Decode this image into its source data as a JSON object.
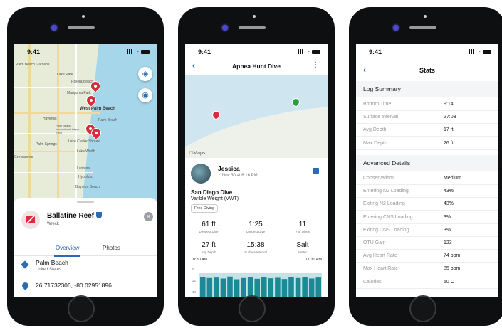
{
  "phone1": {
    "status_time": "9:41",
    "map_labels": [
      "Palm Beach Gardens",
      "Lake Park",
      "Riviera Beach",
      "Mangonia Park",
      "West Palm Beach",
      "Palm Beach",
      "Haverhill",
      "Palm Beach International Airport (PBI)",
      "Palm Springs",
      "Lake Clarke Shores",
      "Greenacres",
      "Lake Worth",
      "Lantana",
      "Hypoluxo",
      "Boynton Beach"
    ],
    "reef_title": "Ballatine Reef",
    "reef_type": "Wreck",
    "tabs": [
      "Overview",
      "Photos"
    ],
    "location_name": "Palm Beach",
    "location_country": "United States",
    "coordinates": "26.71732306, -80.02951896"
  },
  "phone2": {
    "status_time": "9:41",
    "nav_title": "Apnea Hunt Dive",
    "maps_label": "Maps",
    "user_name": "Jessica",
    "user_date": "Nov 30 at 6:16 PM",
    "dive_title": "San Diego Dive",
    "dive_subtitle": "Varible Weight (VWT)",
    "chip": "Free Diving",
    "stats": [
      {
        "value": "61 ft",
        "label": "Deepest Dive"
      },
      {
        "value": "1:25",
        "label": "Longest Dive"
      },
      {
        "value": "11",
        "label": "# of Dives"
      },
      {
        "value": "27 ft",
        "label": "Avg Depth"
      },
      {
        "value": "15:38",
        "label": "Surface Interval"
      },
      {
        "value": "Salt",
        "label": "Water"
      }
    ],
    "time_start": "10:30 AM",
    "time_end": "11:30 AM",
    "y_ticks": [
      "0",
      "22",
      "44"
    ],
    "chart_data": {
      "type": "bar",
      "series_color": "#1b8a96",
      "note_values_are_depth_fraction_of_max": true,
      "values": [
        0.85,
        0.8,
        0.82,
        0.78,
        0.86,
        0.75,
        0.8,
        0.83,
        0.77,
        0.84,
        0.79,
        0.81,
        0.76,
        0.83,
        0.8,
        0.85,
        0.78,
        0.82
      ]
    }
  },
  "phone3": {
    "status_time": "9:41",
    "nav_title": "Stats",
    "section1": "Log Summary",
    "log_summary": [
      {
        "k": "Bottom Time",
        "v": "9:14"
      },
      {
        "k": "Surface Interval",
        "v": "27:03"
      },
      {
        "k": "Avg Depth",
        "v": "17 ft"
      },
      {
        "k": "Max Depth",
        "v": "26 ft"
      }
    ],
    "section2": "Advanced Details",
    "advanced": [
      {
        "k": "Conservatism",
        "v": "Medium"
      },
      {
        "k": "Entering N2 Loading",
        "v": "43%"
      },
      {
        "k": "Exiting N2 Loading",
        "v": "43%"
      },
      {
        "k": "Entering CNS Loading",
        "v": "3%"
      },
      {
        "k": "Exiting CNS Loading",
        "v": "3%"
      },
      {
        "k": "OTU Gain",
        "v": "123"
      },
      {
        "k": "Avg Heart Rate",
        "v": "74 bpm"
      },
      {
        "k": "Max Heart Rate",
        "v": "85 bpm"
      },
      {
        "k": "Calories",
        "v": "50 C"
      }
    ]
  }
}
